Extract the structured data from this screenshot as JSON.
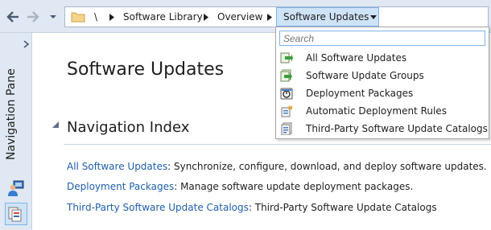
{
  "address_bar": {
    "root_label": "\\",
    "crumbs": [
      "Software Library",
      "Overview"
    ],
    "current": "Software Updates"
  },
  "dropdown": {
    "search_placeholder": "Search",
    "items": [
      {
        "label": "All Software Updates",
        "icon": "software-updates-icon"
      },
      {
        "label": "Software Update Groups",
        "icon": "update-groups-icon"
      },
      {
        "label": "Deployment Packages",
        "icon": "deployment-package-icon"
      },
      {
        "label": "Automatic Deployment Rules",
        "icon": "deployment-rules-icon"
      },
      {
        "label": "Third-Party Software Update Catalogs",
        "icon": "catalog-icon"
      }
    ]
  },
  "nav_pane": {
    "label": "Navigation Pane"
  },
  "main": {
    "title": "Software Updates",
    "section_title": "Navigation Index",
    "index": [
      {
        "link": "All Software Updates",
        "desc": ": Synchronize, configure, download, and deploy software updates."
      },
      {
        "link": "Deployment Packages",
        "desc": ": Manage software update deployment packages."
      },
      {
        "link": "Third-Party Software Update Catalogs",
        "desc": ": Third-Party Software Update Catalogs"
      }
    ]
  },
  "colors": {
    "chrome": "#dfe8f3",
    "link": "#1f5fad",
    "selection": "#cfe3f7"
  }
}
